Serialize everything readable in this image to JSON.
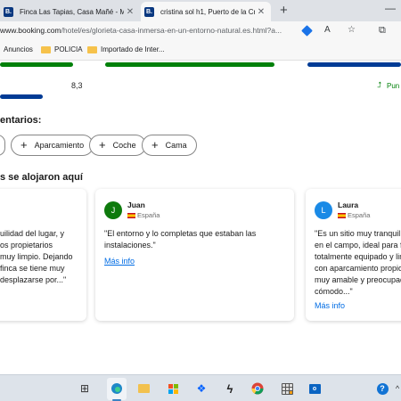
{
  "browser": {
    "tabs": [
      {
        "title": "Finca Las Tapias, Casa Mañé - Mes",
        "favicon": "B.",
        "active": false
      },
      {
        "title": "cristina sol h1, Puerto de la Cruz (",
        "favicon": "B.",
        "active": true
      }
    ],
    "new_tab_icon": "plus-icon",
    "address": {
      "host": "www.booking.com",
      "path": "/hotel/es/glorieta-casa-inmersa-en-un-entorno-natural.es.html?a..."
    },
    "bookmarks": [
      "Anuncios",
      "POLICIA",
      "Importado de Inter..."
    ]
  },
  "page": {
    "bars": [
      {
        "color": "#008009",
        "fill": 1.0
      },
      {
        "color": "#008009",
        "fill": 1.0
      },
      {
        "color": "#003b95",
        "fill": 1.0
      },
      {
        "color": "#003b95",
        "fill": 0.83
      }
    ],
    "score": "8,3",
    "trend_label": "Pun",
    "comments_heading": "entarios:",
    "chips": [
      "Aparcamiento",
      "Coche",
      "Cama"
    ],
    "reviews_heading": "s se alojaron aquí",
    "reviews": [
      {
        "name": "",
        "country": "",
        "avatar_color": "#0e7a0d",
        "quote_lines": [
          "uilidad del lugar, y",
          "os propietarios",
          "muy limpio. Dejando",
          "finca se tiene muy",
          "desplazarse por...\""
        ],
        "more": ""
      },
      {
        "name": "Juan",
        "initial": "J",
        "country": "España",
        "avatar_color": "#0e7a0d",
        "quote_lines": [
          "\"El entorno y lo completas que estaban las",
          "instalaciones.\""
        ],
        "more": "Más info"
      },
      {
        "name": "Laura",
        "initial": "L",
        "country": "España",
        "avatar_color": "#1a8ae6",
        "quote_lines": [
          "\"Es un sitio muy tranquil",
          "en el campo, ideal para f",
          "totalmente equipado y lim",
          "con aparcamiento propio",
          "muy amable y preocupad",
          "cómodo...\""
        ],
        "more": "Más info"
      }
    ]
  },
  "taskbar": {
    "items": [
      "task-view-icon",
      "edge-icon",
      "file-explorer-icon",
      "store-icon",
      "dropbox-icon",
      "app-icon",
      "chrome-icon",
      "calculator-icon",
      "outlook-icon",
      "help-icon"
    ]
  }
}
